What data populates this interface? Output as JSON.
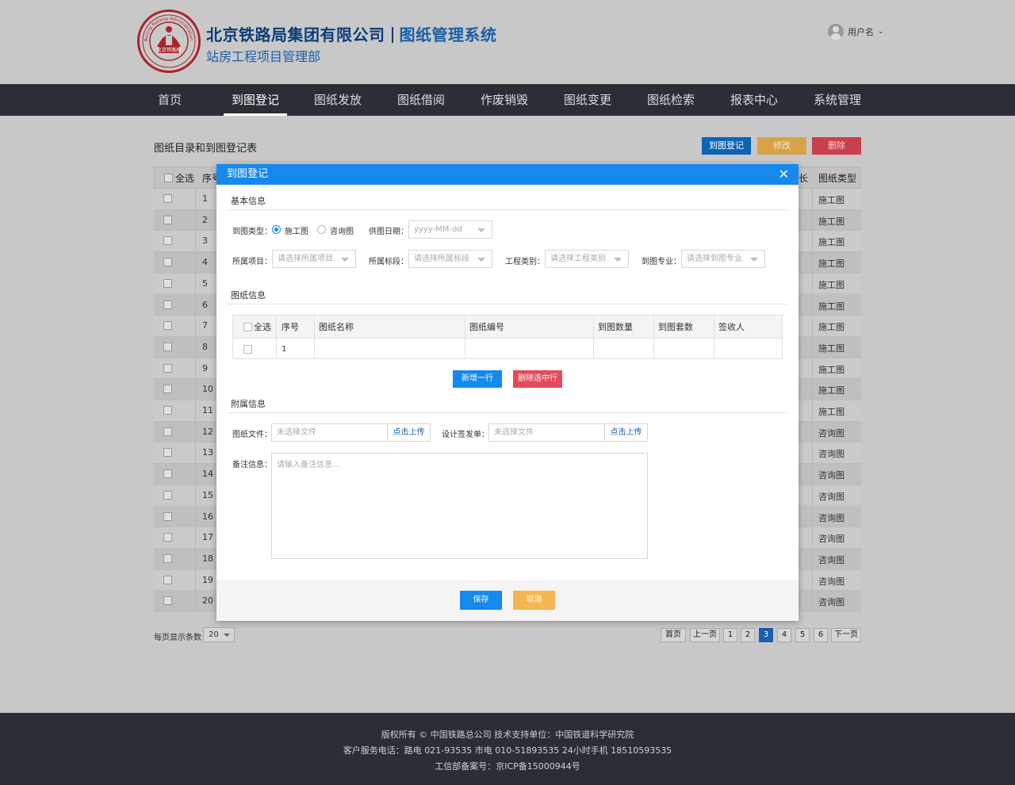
{
  "header": {
    "logo_text": "北京铁路局",
    "logo_ring_text": "Beijing Railway Administration",
    "company": "北京铁路局集团有限公司",
    "system": "图纸管理系统",
    "department": "站房工程项目管理部",
    "user_label": "用户名"
  },
  "nav": {
    "items": [
      {
        "label": "首页"
      },
      {
        "label": "到图登记"
      },
      {
        "label": "图纸发放"
      },
      {
        "label": "图纸借阅"
      },
      {
        "label": "作废销毁"
      },
      {
        "label": "图纸变更"
      },
      {
        "label": "图纸检索"
      },
      {
        "label": "报表中心"
      },
      {
        "label": "系统管理"
      }
    ],
    "active_index": 1
  },
  "page": {
    "title": "图纸目录和到图登记表",
    "actions": {
      "register": "到图登记",
      "edit": "修改",
      "delete": "删除"
    }
  },
  "table": {
    "columns": {
      "select_all": "全选",
      "no": "序号",
      "type": "图纸类型",
      "partial_right": "长"
    },
    "rows": [
      {
        "no": "1",
        "type": "施工图"
      },
      {
        "no": "2",
        "type": "施工图"
      },
      {
        "no": "3",
        "type": "施工图"
      },
      {
        "no": "4",
        "type": "施工图"
      },
      {
        "no": "5",
        "type": "施工图"
      },
      {
        "no": "6",
        "type": "施工图"
      },
      {
        "no": "7",
        "type": "施工图"
      },
      {
        "no": "8",
        "type": "施工图"
      },
      {
        "no": "9",
        "type": "施工图"
      },
      {
        "no": "10",
        "type": "施工图"
      },
      {
        "no": "11",
        "type": "施工图"
      },
      {
        "no": "12",
        "type": "咨询图"
      },
      {
        "no": "13",
        "type": "咨询图"
      },
      {
        "no": "14",
        "type": "咨询图"
      },
      {
        "no": "15",
        "type": "咨询图"
      },
      {
        "no": "16",
        "type": "咨询图"
      },
      {
        "no": "17",
        "type": "咨询图"
      },
      {
        "no": "18",
        "type": "咨询图"
      },
      {
        "no": "19",
        "type": "咨询图"
      },
      {
        "no": "20",
        "type": "咨询图"
      }
    ]
  },
  "pager": {
    "per_page_label": "每页显示条数",
    "per_page_value": "20",
    "first": "首页",
    "prev": "上一页",
    "pages": [
      "1",
      "2",
      "3",
      "4",
      "5",
      "6"
    ],
    "current_page": "3",
    "next": "下一页"
  },
  "modal": {
    "title": "到图登记",
    "close": "✕",
    "basic": {
      "heading": "基本信息",
      "type_label": "到图类型：",
      "type_options": [
        "施工图",
        "咨询图"
      ],
      "type_selected": "施工图",
      "date_label": "供图日期：",
      "date_placeholder": "yyyy-MM-dd",
      "project_label": "所属项目：",
      "project_placeholder": "请选择所属项目",
      "section_label": "所属标段：",
      "section_placeholder": "请选择所属标段",
      "category_label": "工程类别：",
      "category_placeholder": "请选择工程类别",
      "major_label": "到图专业：",
      "major_placeholder": "请选择到图专业"
    },
    "drawings": {
      "heading": "图纸信息",
      "columns": [
        "全选",
        "序号",
        "图纸名称",
        "图纸编号",
        "到图数量",
        "到图套数",
        "签收人"
      ],
      "rows": [
        {
          "no": "1"
        }
      ],
      "add_row": "新增一行",
      "delete_row": "删除选中行"
    },
    "attach": {
      "heading": "附属信息",
      "file_label": "图纸文件：",
      "file_placeholder": "未选择文件",
      "file_upload": "点击上传",
      "sign_label": "设计签发单：",
      "sign_placeholder": "未选择文件",
      "sign_upload": "点击上传",
      "note_label": "备注信息：",
      "note_placeholder": "请输入备注信息..."
    },
    "footer": {
      "save": "保存",
      "cancel": "取消"
    }
  },
  "footer": {
    "line1": "版权所有 © 中国铁路总公司 技术支持单位：中国铁道科学研究院",
    "line2": "客户服务电话：路电 021-93535 市电 010-51893535 24小时手机 18510593535",
    "line3": "工信部备案号：京ICP备15000944号"
  },
  "colors": {
    "nav_bg": "#2b2e36",
    "modal_header": "#1589ee",
    "primary": "#0d63b5",
    "warning": "#d8a347",
    "danger": "#c9404c",
    "brand": "#0d3c7a",
    "logo_red": "#a8242b"
  }
}
